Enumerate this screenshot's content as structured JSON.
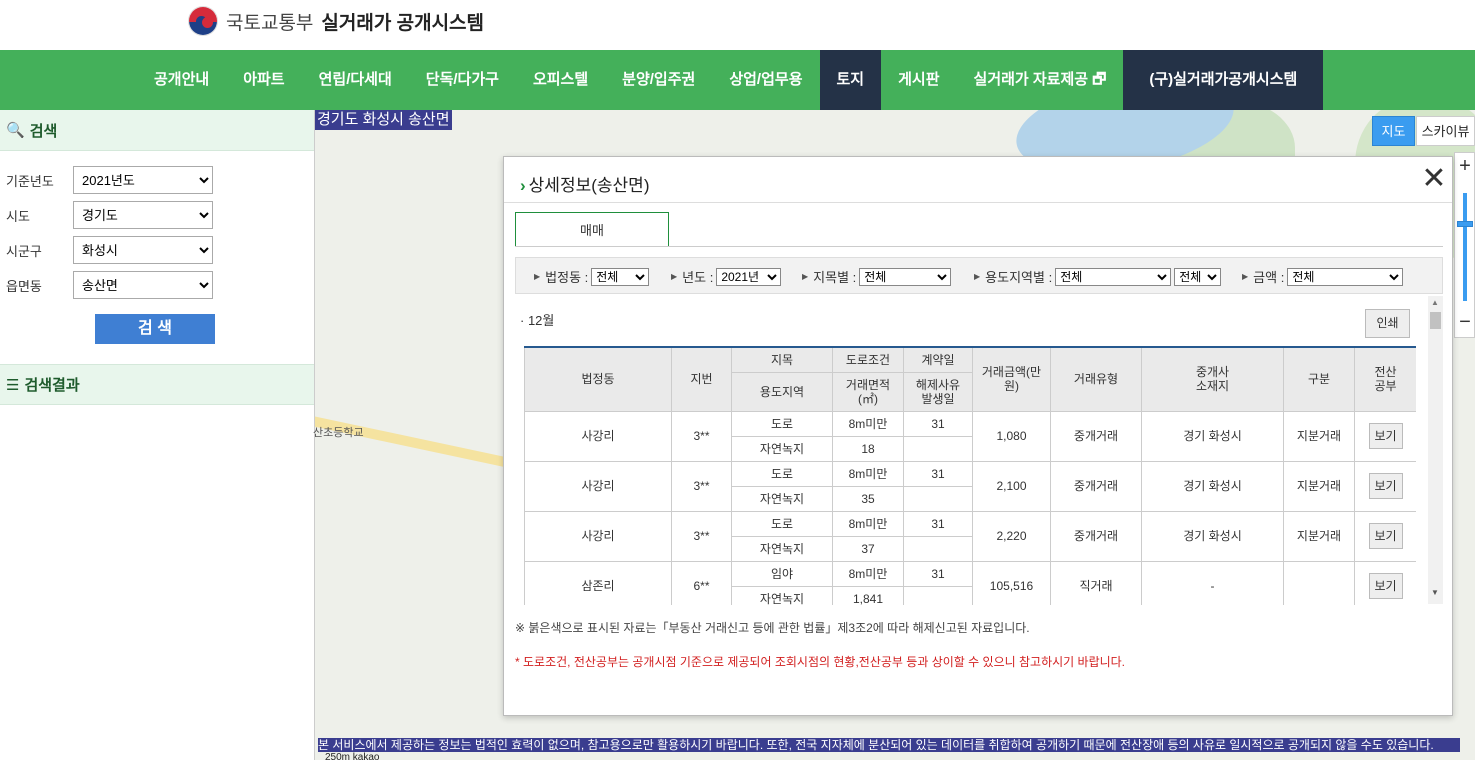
{
  "header": {
    "ministry": "국토교통부",
    "system": "실거래가 공개시스템"
  },
  "nav": {
    "items": [
      "공개안내",
      "아파트",
      "연립/다세대",
      "단독/다가구",
      "오피스텔",
      "분양/입주권",
      "상업/업무용",
      "토지",
      "게시판",
      "실거래가 자료제공 🗗",
      "(구)실거래가공개시스템"
    ],
    "active": "토지"
  },
  "sidebar": {
    "search_title": "검색",
    "fields": [
      {
        "label": "기준년도",
        "value": "2021년도"
      },
      {
        "label": "시도",
        "value": "경기도"
      },
      {
        "label": "시군구",
        "value": "화성시"
      },
      {
        "label": "읍면동",
        "value": "송산면"
      }
    ],
    "search_button": "검 색",
    "result_title": "검색결과"
  },
  "map": {
    "location_label": "경기도 화성시 송산면",
    "place_label": "산초등학교",
    "map_button": "지도",
    "sky_button": "스카이뷰",
    "zoom_in": "+",
    "zoom_out": "−",
    "disclaimer": "본 서비스에서 제공하는 정보는 법적인 효력이 없으며, 참고용으로만 활용하시기 바랍니다. 또한, 전국 지자체에 분산되어 있는 데이터를 취합하여 공개하기 때문에 전산장애 등의 사유로 일시적으로 공개되지 않을 수도 있습니다.",
    "scale": "250m  kakao"
  },
  "panel": {
    "title": "상세정보(송산면)",
    "close": "✕",
    "tab": "매매",
    "filters": {
      "dong_label": "법정동 :",
      "dong_value": "전체",
      "year_label": "년도 :",
      "year_value": "2021년",
      "jimok_label": "지목별 :",
      "jimok_value": "전체",
      "zone_label": "용도지역별 :",
      "zone_value": "전체",
      "zone_value2": "전체",
      "amount_label": "금액 :",
      "amount_value": "전체"
    },
    "month": "· 12월",
    "print": "인쇄",
    "table": {
      "headers": {
        "dong": "법정동",
        "jibun": "지번",
        "jimok": "지목",
        "road": "도로조건",
        "contract": "계약일",
        "price": "거래금액(만원)",
        "type": "거래유형",
        "broker": "중개사\n소재지",
        "kind": "구분",
        "doc": "전산\n공부",
        "zone": "용도지역",
        "area": "거래면적\n(㎡)",
        "cancel": "해제사유\n발생일"
      },
      "rows": [
        {
          "dong": "사강리",
          "jibun": "3**",
          "jimok": "도로",
          "road": "8m미만",
          "contract": "31",
          "zone": "자연녹지",
          "area": "18",
          "cancel": "",
          "price": "1,080",
          "type": "중개거래",
          "broker": "경기 화성시",
          "kind": "지분거래",
          "doc": "보기"
        },
        {
          "dong": "사강리",
          "jibun": "3**",
          "jimok": "도로",
          "road": "8m미만",
          "contract": "31",
          "zone": "자연녹지",
          "area": "35",
          "cancel": "",
          "price": "2,100",
          "type": "중개거래",
          "broker": "경기 화성시",
          "kind": "지분거래",
          "doc": "보기"
        },
        {
          "dong": "사강리",
          "jibun": "3**",
          "jimok": "도로",
          "road": "8m미만",
          "contract": "31",
          "zone": "자연녹지",
          "area": "37",
          "cancel": "",
          "price": "2,220",
          "type": "중개거래",
          "broker": "경기 화성시",
          "kind": "지분거래",
          "doc": "보기"
        },
        {
          "dong": "삼존리",
          "jibun": "6**",
          "jimok": "임야",
          "road": "8m미만",
          "contract": "31",
          "zone": "자연녹지",
          "area": "1,841",
          "cancel": "",
          "price": "105,516",
          "type": "직거래",
          "broker": "-",
          "kind": "",
          "doc": "보기"
        }
      ]
    },
    "note1": "※ 붉은색으로 표시된 자료는「부동산 거래신고 등에 관한 법률」제3조2에 따라 해제신고된 자료입니다.",
    "note2": "* 도로조건, 전산공부는 공개시점 기준으로 제공되어 조회시점의 현황,전산공부 등과 상이할 수 있으니 참고하시기 바랍니다."
  }
}
